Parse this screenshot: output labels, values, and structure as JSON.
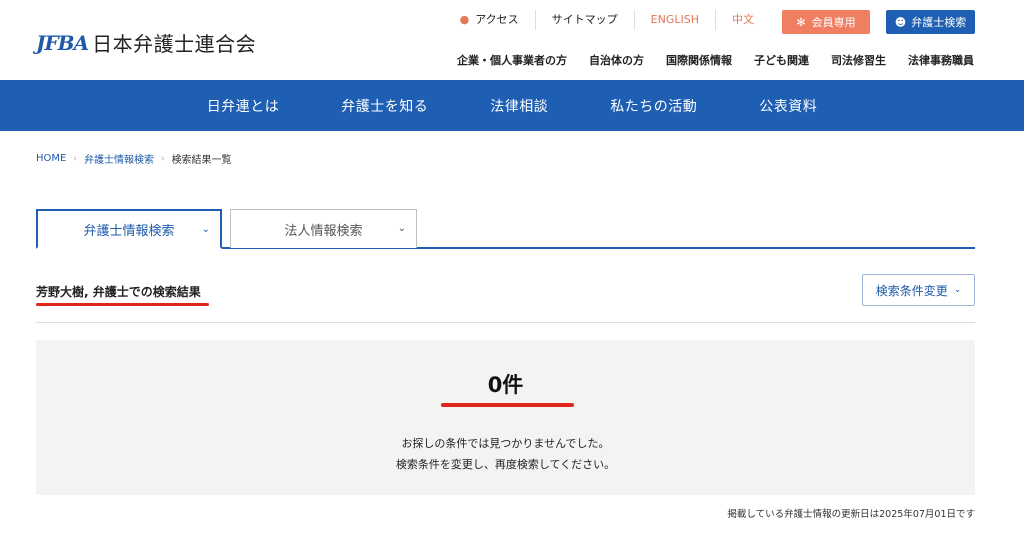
{
  "header": {
    "logo_mark": "JFBA",
    "logo_text": "日本弁護士連合会",
    "util_nav": [
      "アクセス",
      "サイトマップ",
      "ENGLISH",
      "中文"
    ],
    "member_button": "会員専用",
    "lawyer_search_button": "弁護士検索",
    "sub_nav": [
      "企業・個人事業者の方",
      "自治体の方",
      "国際関係情報",
      "子ども関連",
      "司法修習生",
      "法律事務職員"
    ]
  },
  "global_nav": [
    "日弁連とは",
    "弁護士を知る",
    "法律相談",
    "私たちの活動",
    "公表資料"
  ],
  "breadcrumb": {
    "home": "HOME",
    "parent": "弁護士情報検索",
    "current": "検索結果一覧"
  },
  "tabs": {
    "active": "弁護士情報検索",
    "inactive": "法人情報検索"
  },
  "result": {
    "title": "芳野大樹, 弁護士での検索結果",
    "change_button": "検索条件変更",
    "count": "0件",
    "message_line1": "お探しの条件では見つかりませんでした。",
    "message_line2": "検索条件を変更し、再度検索してください。",
    "update_note": "掲載している弁護士情報の更新日は2025年07月01日です"
  },
  "colors": {
    "brand_blue": "#1e5fb4",
    "member_orange": "#ef7e62",
    "highlight_red": "#e0251b"
  }
}
